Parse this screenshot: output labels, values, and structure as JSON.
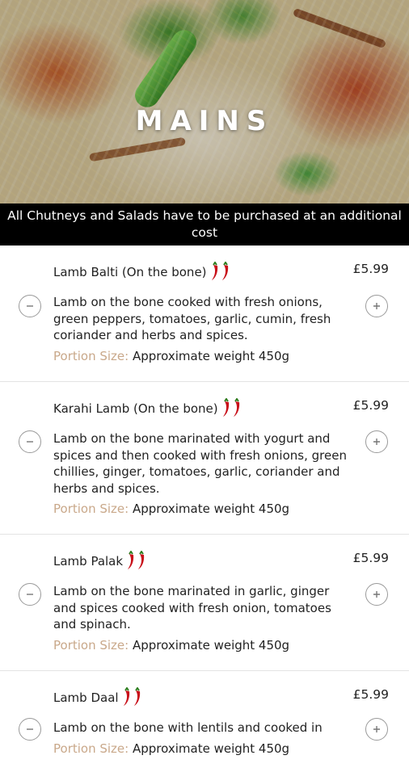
{
  "hero": {
    "title": "MAINS"
  },
  "notice": "All Chutneys and Salads have to be purchased at an additional cost",
  "items": [
    {
      "name": "Lamb Balti (On the bone)",
      "price": "£5.99",
      "description": "Lamb on the bone cooked with fresh onions, green peppers, tomatoes, garlic, cumin, fresh coriander and herbs and spices.",
      "portion_label": "Portion Size:",
      "portion_value": "Approximate weight 450g"
    },
    {
      "name": "Karahi Lamb (On the bone)",
      "price": "£5.99",
      "description": "Lamb on the bone marinated with yogurt and spices and then cooked with fresh onions, green chillies, ginger, tomatoes, garlic, coriander and herbs and spices.",
      "portion_label": "Portion Size:",
      "portion_value": "Approximate weight 450g"
    },
    {
      "name": "Lamb Palak",
      "price": "£5.99",
      "description": "Lamb on the bone marinated in garlic, ginger and spices cooked with fresh onion, tomatoes and spinach.",
      "portion_label": "Portion Size:",
      "portion_value": "Approximate weight 450g"
    },
    {
      "name": "Lamb Daal",
      "price": "£5.99",
      "description": "Lamb on the bone with lentils and cooked in",
      "portion_label": "Portion Size:",
      "portion_value": "Approximate weight 450g"
    }
  ],
  "icons": {
    "spicy": "chilli-icon",
    "decrease": "minus-icon",
    "increase": "plus-icon"
  },
  "colors": {
    "notice_bg": "#000000",
    "portion_label": "#c9a88a",
    "chilli": "#c8101a"
  }
}
